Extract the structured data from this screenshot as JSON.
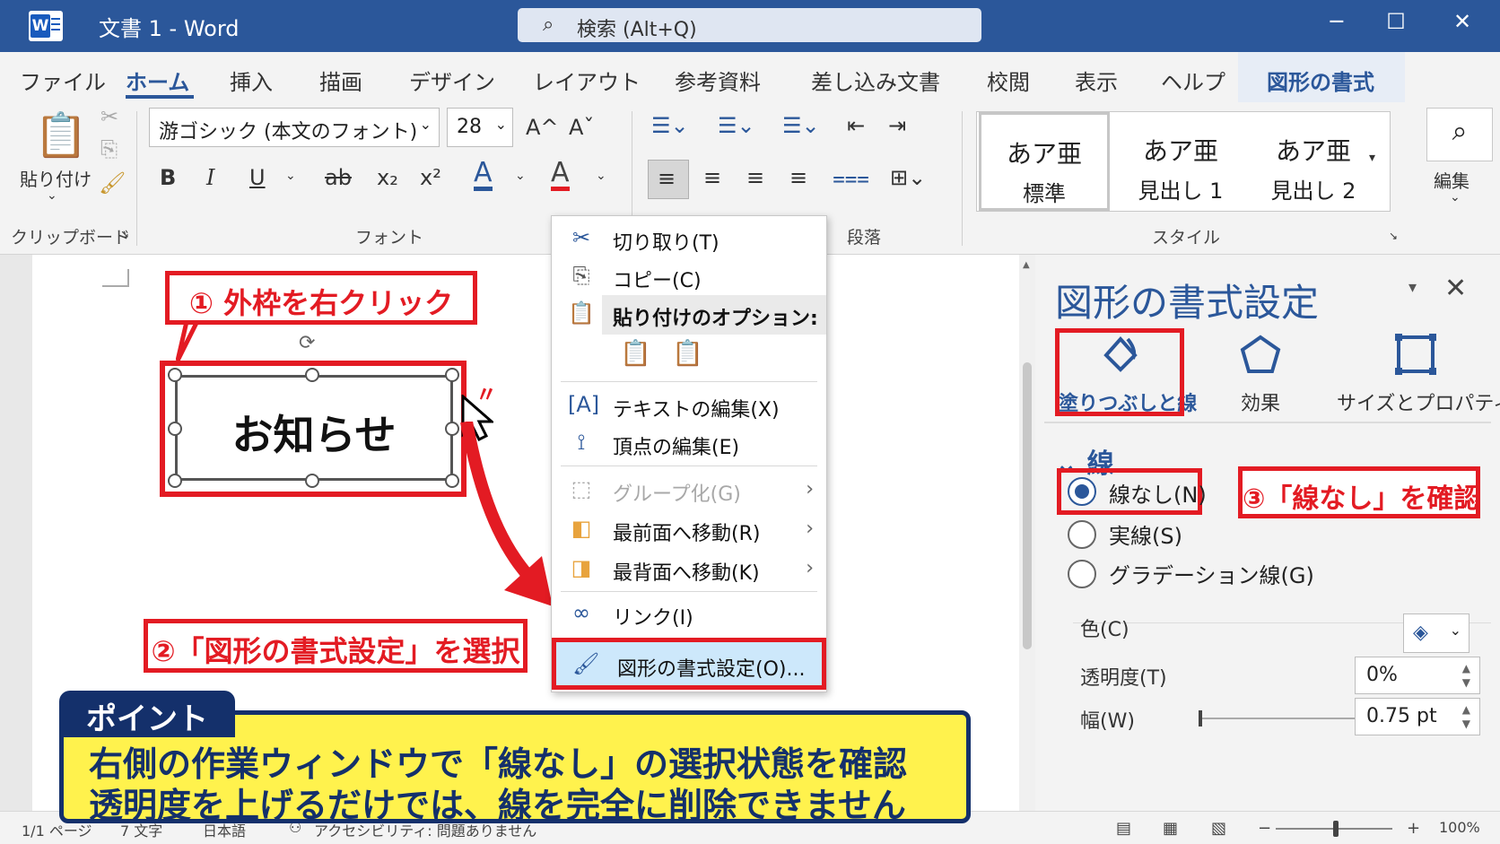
{
  "titlebar": {
    "doc_title": "文書 1  -  Word",
    "search_placeholder": "検索 (Alt+Q)",
    "search_icon": "search-icon",
    "minimize_glyph": "─",
    "maximize_glyph": "☐",
    "close_glyph": "✕",
    "accent": "#2b579a"
  },
  "menu": {
    "tabs": [
      "ファイル",
      "ホーム",
      "挿入",
      "描画",
      "デザイン",
      "レイアウト",
      "参考資料",
      "差し込み文書",
      "校閲",
      "表示",
      "ヘルプ",
      "図形の書式"
    ],
    "active_tab": "ホーム"
  },
  "ribbon": {
    "clipboard": {
      "paste_label": "貼り付け",
      "group_label": "クリップボード"
    },
    "font": {
      "font_name": "游ゴシック (本文のフォント)",
      "font_size": "28",
      "grow_glyph": "A^",
      "shrink_glyph": "Aˇ",
      "bold": "B",
      "italic": "I",
      "underline": "U",
      "strike": "ab",
      "subscript": "x₂",
      "superscript": "x²",
      "font_color_glyph": "A",
      "highlight_glyph": "A",
      "group_label": "フォント"
    },
    "paragraph": {
      "group_label": "段落"
    },
    "styles": {
      "items": [
        {
          "sample": "あア亜",
          "name": "標準"
        },
        {
          "sample": "あア亜",
          "name": "見出し 1"
        },
        {
          "sample": "あア亜",
          "name": "見出し 2"
        }
      ],
      "group_label": "スタイル"
    },
    "editing": {
      "label": "編集"
    }
  },
  "document": {
    "shape_text": "お知らせ"
  },
  "callouts": {
    "step1": "① 外枠を右クリック",
    "step2": "②「図形の書式設定」を選択",
    "step3": "③「線なし」を確認"
  },
  "context_menu": {
    "items": [
      {
        "icon": "scissors-icon",
        "label": "切り取り(T)"
      },
      {
        "icon": "copy-icon",
        "label": "コピー(C)"
      },
      {
        "icon": "paste-icon",
        "label": "貼り付けのオプション:"
      },
      {
        "icon": "edit-text-icon",
        "label": "テキストの編集(X)"
      },
      {
        "icon": "edit-points-icon",
        "label": "頂点の編集(E)"
      },
      {
        "icon": "group-icon",
        "label": "グループ化(G)"
      },
      {
        "icon": "bring-front-icon",
        "label": "最前面へ移動(R)"
      },
      {
        "icon": "send-back-icon",
        "label": "最背面へ移動(K)"
      },
      {
        "icon": "link-icon",
        "label": "リンク(I)"
      },
      {
        "icon": "format-shape-icon",
        "label": "図形の書式設定(O)..."
      }
    ]
  },
  "task_pane": {
    "title": "図形の書式設定",
    "tabs": [
      {
        "icon": "paint-bucket-icon",
        "label": "塗りつぶしと線"
      },
      {
        "icon": "pentagon-icon",
        "label": "効果"
      },
      {
        "icon": "size-icon",
        "label": "サイズとプロパティ"
      }
    ],
    "section": "線",
    "line_options": [
      "線なし(N)",
      "実線(S)",
      "グラデーション線(G)"
    ],
    "selected_line_option": "線なし(N)",
    "color_label": "色(C)",
    "transparency_label": "透明度(T)",
    "transparency_value": "0%",
    "width_label": "幅(W)",
    "width_value": "0.75 pt"
  },
  "point": {
    "tag": "ポイント",
    "line1": "右側の作業ウィンドウで「線なし」の選択状態を確認",
    "line2": "透明度を上げるだけでは、線を完全に削除できません"
  },
  "statusbar": {
    "page": "1/1 ページ",
    "words": "7 文字",
    "language": "日本語",
    "accessibility": "アクセシビリティ: 問題ありません",
    "zoom": "100%"
  },
  "colors": {
    "highlight_red": "#e31b23",
    "point_yellow": "#fff24d",
    "point_navy": "#14306b"
  }
}
